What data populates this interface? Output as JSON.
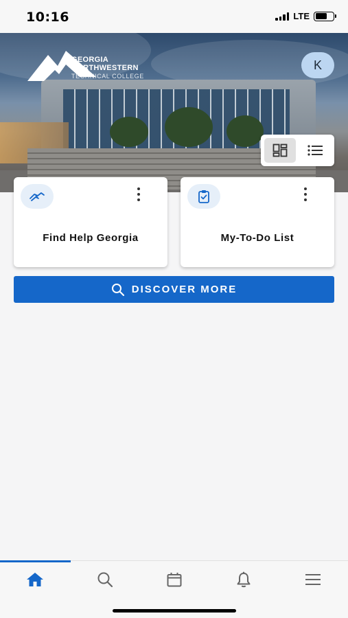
{
  "status_bar": {
    "time": "10:16",
    "network": "LTE",
    "battery_level": 0.65
  },
  "hero": {
    "logo": {
      "line1": "GEORGIA",
      "line2": "NORTHWESTERN",
      "line3": "TECHNICAL COLLEGE"
    },
    "avatar_initial": "K"
  },
  "view_toggle": {
    "options": [
      "grid-view-icon",
      "list-view-icon"
    ],
    "selected": "grid"
  },
  "cards": [
    {
      "title": "Find Help Georgia",
      "icon": "helping-hand-icon"
    },
    {
      "title": "My-To-Do List",
      "icon": "clipboard-check-icon"
    }
  ],
  "discover_button": {
    "label": "DISCOVER MORE",
    "icon": "search-icon"
  },
  "tabbar": {
    "tabs": [
      "home-icon",
      "search-icon",
      "calendar-icon",
      "bell-icon",
      "menu-icon"
    ],
    "active": "home"
  },
  "colors": {
    "accent": "#1567c9",
    "avatar_bg": "#bcd6f1",
    "card_icon_bg": "#e6eff9"
  }
}
